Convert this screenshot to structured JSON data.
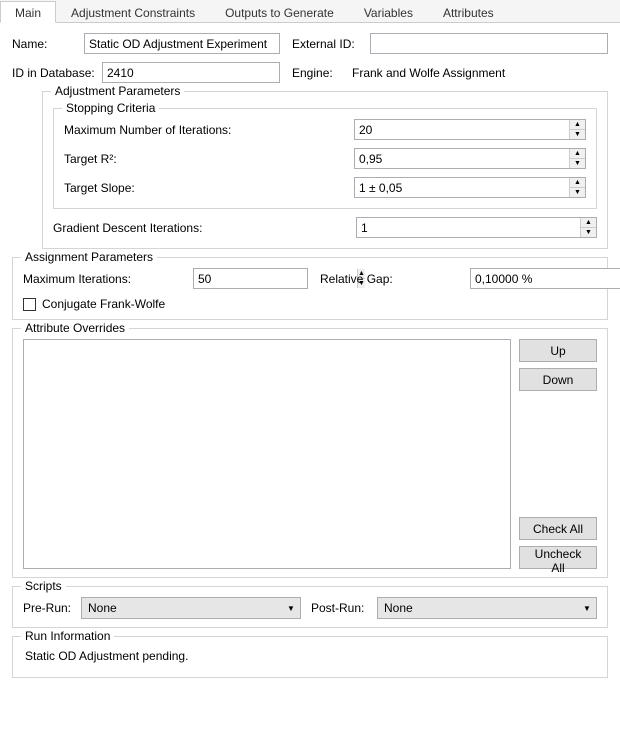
{
  "tabs": {
    "main": "Main",
    "constraints": "Adjustment Constraints",
    "outputs": "Outputs to Generate",
    "variables": "Variables",
    "attributes": "Attributes"
  },
  "header": {
    "name_label": "Name:",
    "name_value": "Static OD Adjustment Experiment",
    "external_id_label": "External ID:",
    "external_id_value": "",
    "db_id_label": "ID in Database:",
    "db_id_value": "2410",
    "engine_label": "Engine:",
    "engine_value": "Frank and Wolfe Assignment"
  },
  "adjustment": {
    "title": "Adjustment Parameters",
    "stopping": {
      "title": "Stopping Criteria",
      "max_iter_label": "Maximum Number of Iterations:",
      "max_iter_value": "20",
      "target_r2_label": "Target R²:",
      "target_r2_value": "0,95",
      "target_slope_label": "Target Slope:",
      "target_slope_value": "1 ± 0,05"
    },
    "gradient_label": "Gradient Descent Iterations:",
    "gradient_value": "1"
  },
  "assignment": {
    "title": "Assignment Parameters",
    "max_iter_label": "Maximum Iterations:",
    "max_iter_value": "50",
    "rel_gap_label": "Relative Gap:",
    "rel_gap_value": "0,10000 %",
    "conjugate_label": "Conjugate Frank-Wolfe"
  },
  "overrides": {
    "title": "Attribute Overrides",
    "up": "Up",
    "down": "Down",
    "check_all": "Check All",
    "uncheck_all": "Uncheck All"
  },
  "scripts": {
    "title": "Scripts",
    "prerun_label": "Pre-Run:",
    "prerun_value": "None",
    "postrun_label": "Post-Run:",
    "postrun_value": "None"
  },
  "runinfo": {
    "title": "Run Information",
    "text": "Static OD Adjustment pending."
  }
}
